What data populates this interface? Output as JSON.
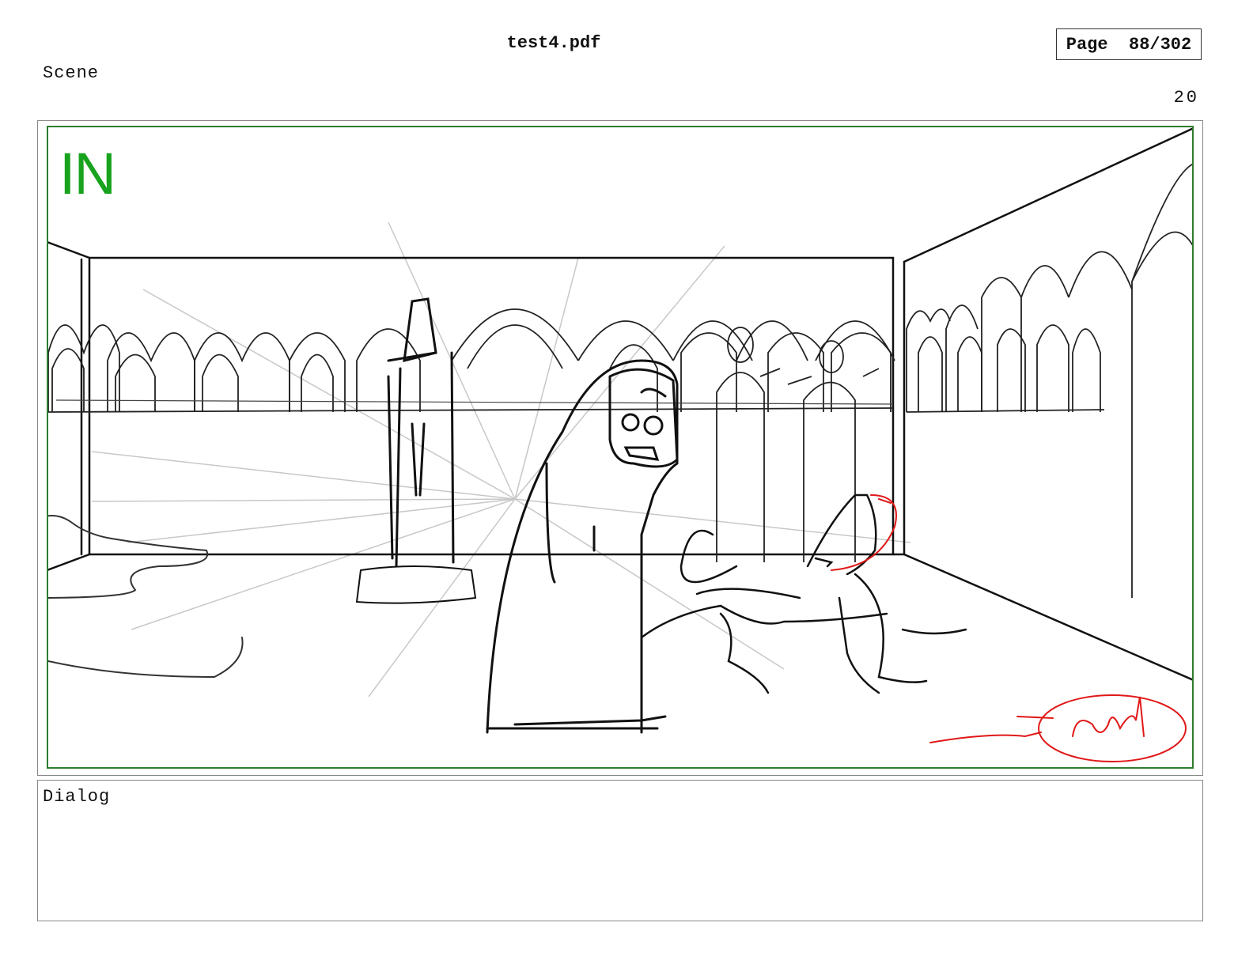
{
  "document": {
    "filename": "test4.pdf",
    "page_indicator": "Page  88/302"
  },
  "scene": {
    "label": "Scene",
    "number": "20"
  },
  "panel": {
    "shot_tag": "IN",
    "colors": {
      "frame_green": "#2e7d2e",
      "shot_tag_green": "#18a31e",
      "sketch_line": "#111111",
      "construction_line": "#c8c8c8",
      "red_markup": "#e01818"
    }
  },
  "dialog": {
    "label": "Dialog",
    "text": ""
  }
}
